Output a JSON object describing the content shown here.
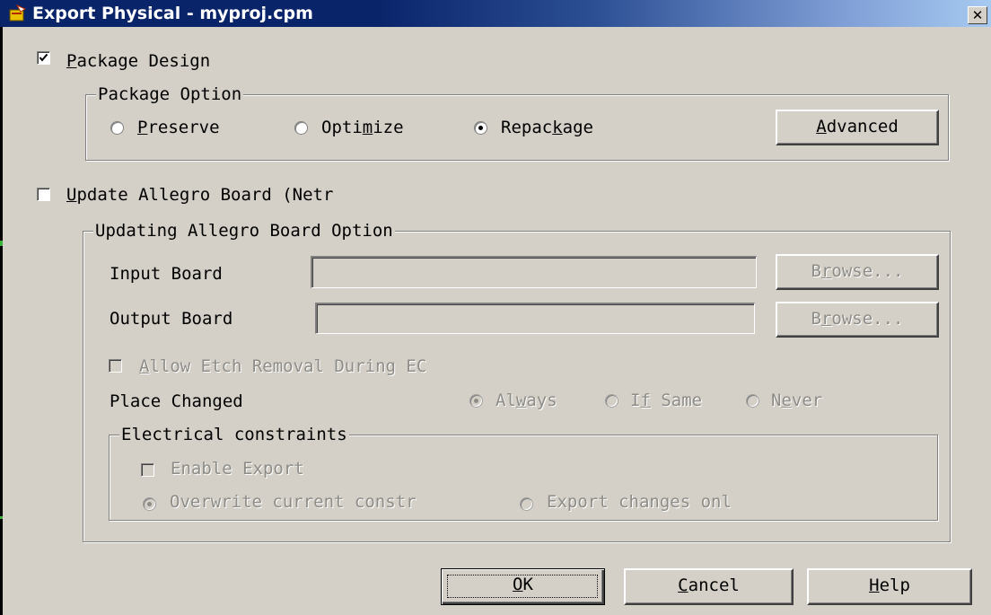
{
  "window": {
    "title": "Export Physical - myproj.cpm",
    "close_glyph": "✕"
  },
  "package_design": {
    "label_pre": "",
    "label_key": "P",
    "label_post": "ackage Design",
    "checked": true
  },
  "package_option": {
    "title": "Package Option",
    "options": [
      {
        "pre": "",
        "key": "P",
        "post": "reserve",
        "selected": false
      },
      {
        "pre": "Opti",
        "key": "m",
        "post": "ize",
        "selected": false
      },
      {
        "pre": "Repac",
        "key": "k",
        "post": "age",
        "selected": true
      }
    ],
    "advanced_button": {
      "key": "A",
      "post": "dvanced"
    }
  },
  "update_board": {
    "key": "U",
    "post": "pdate Allegro Board (Netr",
    "checked": false
  },
  "board_option": {
    "title": "Updating Allegro Board Option",
    "input_board": {
      "label": "Input Board",
      "value": "",
      "browse_pre": "B",
      "browse_key": "r",
      "browse_post": "owse..."
    },
    "output_board": {
      "label": "Output Board",
      "value": "",
      "browse_pre": "B",
      "browse_key": "r",
      "browse_post": "owse..."
    },
    "allow_etch": {
      "key": "A",
      "post": "llow Etch Removal During EC",
      "checked": false
    },
    "place_changed": {
      "label": "Place Changed",
      "options": [
        {
          "pre": "Al",
          "key": "w",
          "post": "ays",
          "selected": true
        },
        {
          "pre": "I",
          "key": "f",
          "post": " Same",
          "selected": false
        },
        {
          "pre": "N",
          "key": "e",
          "post": "ver",
          "selected": false
        }
      ]
    },
    "electrical": {
      "title": "Electrical constraints",
      "enable_export": {
        "label": "Enable Export",
        "checked": false
      },
      "options": [
        {
          "label": "Overwrite current constr",
          "selected": true
        },
        {
          "label": "Export changes onl",
          "selected": false
        }
      ]
    }
  },
  "buttons": {
    "ok": {
      "key": "O",
      "post": "K"
    },
    "cancel": {
      "key": "C",
      "post": "ancel"
    },
    "help": {
      "key": "H",
      "post": "elp"
    }
  },
  "colors": {
    "face": "#d4d0c8",
    "title_start": "#0a246a",
    "title_end": "#a6caf0",
    "disabled_text": "#8e8c87"
  }
}
